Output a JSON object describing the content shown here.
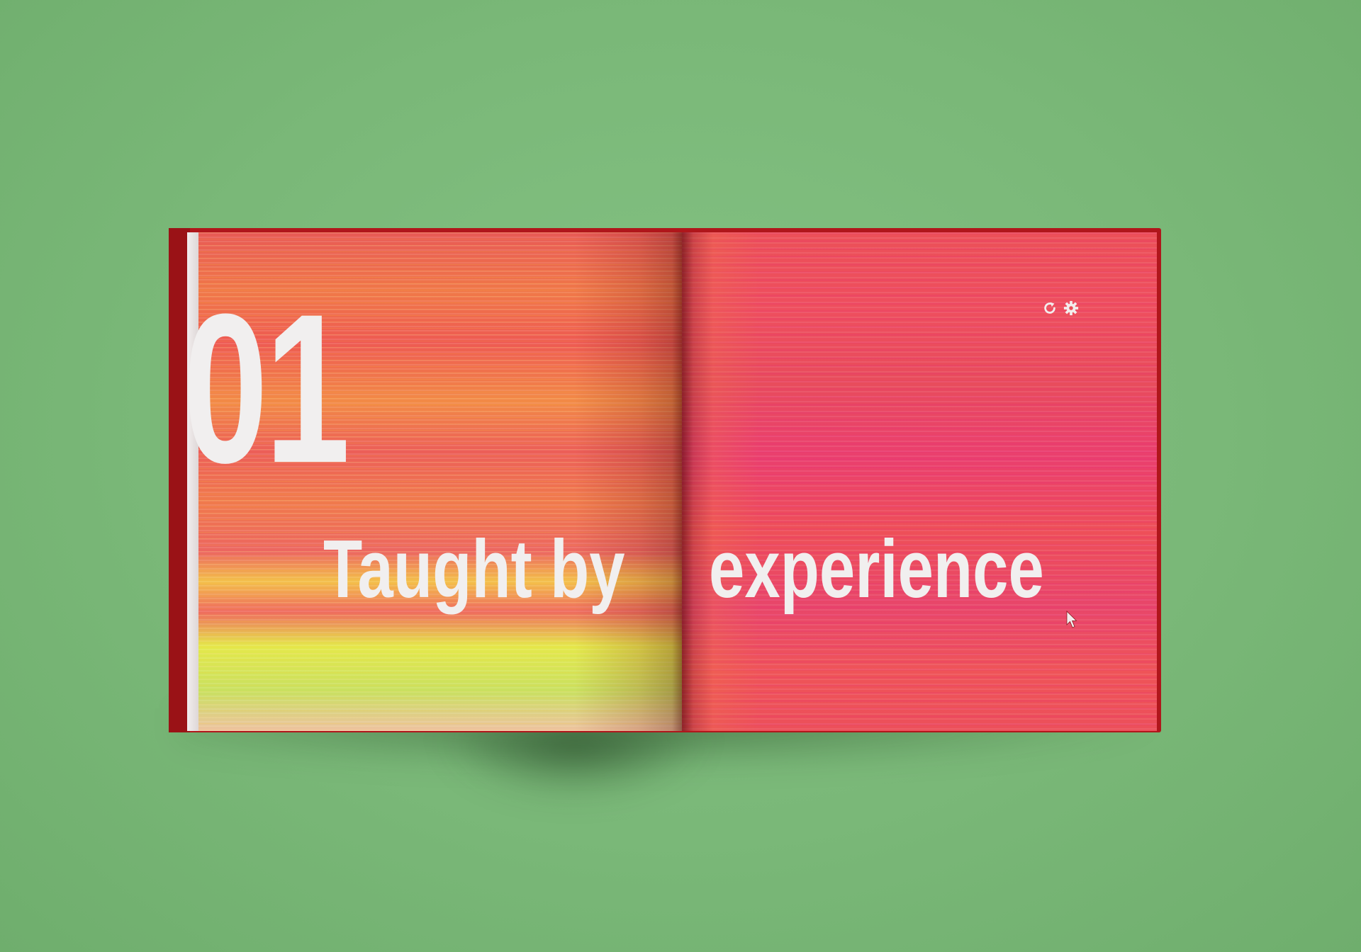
{
  "spread": {
    "chapter_number": "01",
    "title_left": "Taught by",
    "title_right": "experience"
  },
  "icons": [
    "refresh-icon",
    "gear-icon",
    "cursor-arrow-icon"
  ],
  "colors": {
    "background": "#7dba7a",
    "cover": "#b0161b",
    "text": "#f1efef"
  }
}
